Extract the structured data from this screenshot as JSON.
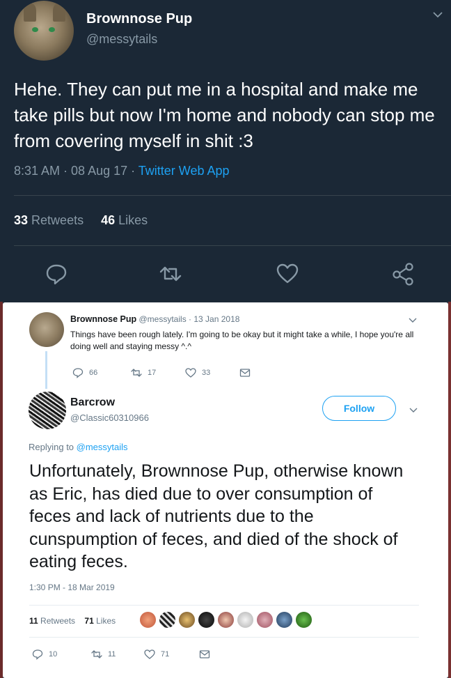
{
  "top_tweet": {
    "display_name": "Brownnose Pup",
    "handle": "@messytails",
    "text": "Hehe. They can put me in a hospital and make me take pills but now I'm home and nobody can stop me from covering myself in shit :3",
    "timestamp": "8:31 AM · 08 Aug 17 · ",
    "client": "Twitter Web App",
    "retweets_count": "33",
    "retweets_label": "Retweets",
    "likes_count": "46",
    "likes_label": "Likes",
    "actions": [
      "reply-icon",
      "retweet-icon",
      "like-icon",
      "share-icon"
    ]
  },
  "quoted_tweet": {
    "display_name": "Brownnose Pup",
    "handle_date": "@messytails · 13 Jan 2018",
    "text": "Things have been rough lately. I'm going to be okay but it might take a while, I hope you're all doing well and staying messy ^.^",
    "reply_count": "66",
    "retweet_count": "17",
    "like_count": "33"
  },
  "reply_tweet": {
    "display_name": "Barcrow",
    "handle": "@Classic60310966",
    "follow_label": "Follow",
    "replying_prefix": "Replying to ",
    "replying_to": "@messytails",
    "text": "Unfortunately, Brownnose Pup, otherwise known as Eric, has died due to over consumption of feces and lack of nutrients due to the cunspumption of feces, and died of the shock of eating feces.",
    "timestamp": "1:30 PM - 18 Mar 2019",
    "retweets_count": "11",
    "retweets_label": "Retweets",
    "likes_count": "71",
    "likes_label": "Likes",
    "reply_count": "10",
    "retweet_count": "11",
    "like_count": "71"
  },
  "colors": {
    "dark_bg": "#1b2836",
    "muted": "#8899a6",
    "accent": "#1da1f2",
    "light_muted": "#657786"
  }
}
